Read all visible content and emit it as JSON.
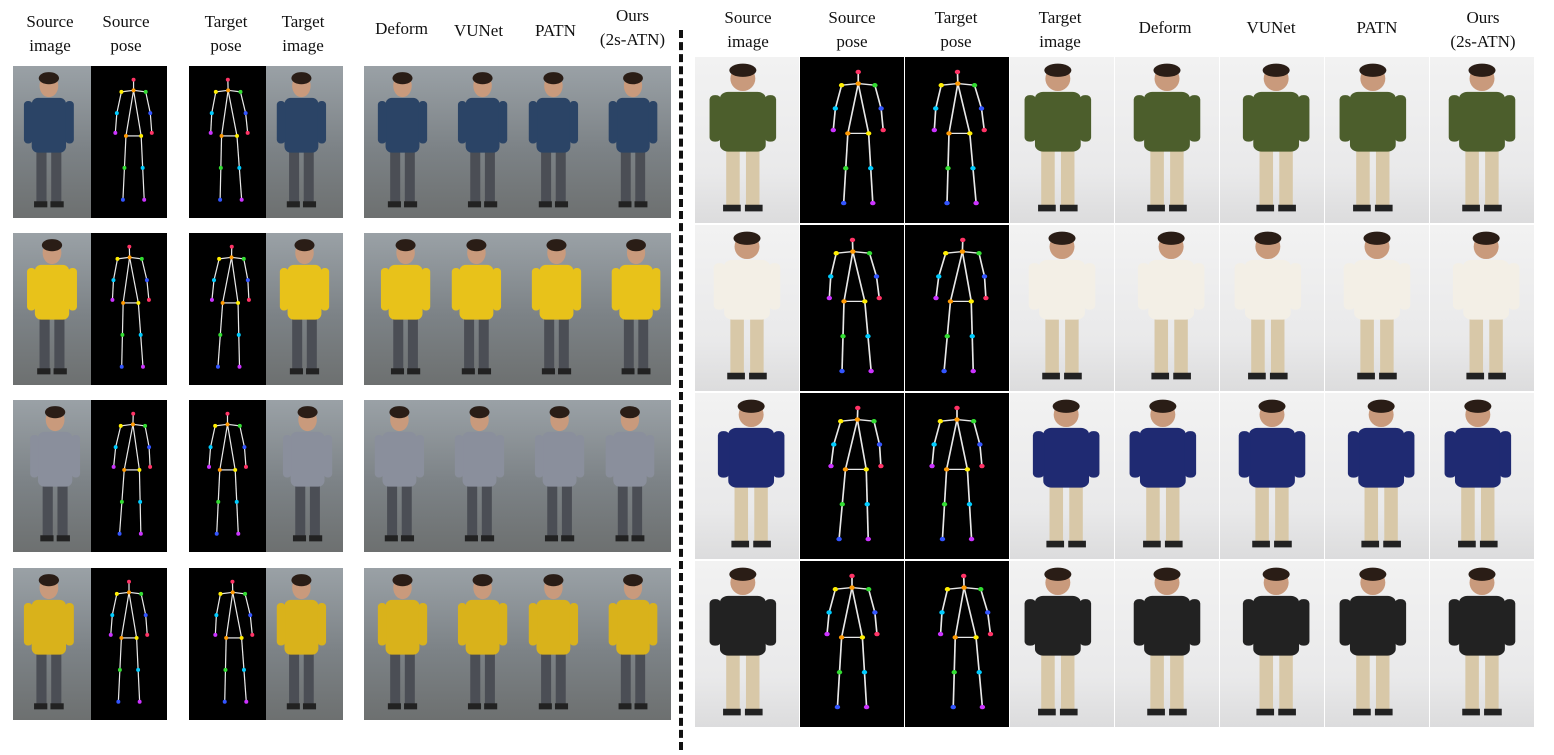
{
  "left_panel": {
    "headers": [
      "Source\nimage",
      "Source\npose",
      "Target\npose",
      "Target\nimage",
      "Deform",
      "VUNet",
      "PATN",
      "Ours\n(2s-ATN)"
    ]
  },
  "right_panel": {
    "headers": [
      "Source\nimage",
      "Source\npose",
      "Target\npose",
      "Target\nimage",
      "Deform",
      "VUNet",
      "PATN",
      "Ours\n(2s-ATN)"
    ]
  },
  "colors": {
    "pose_background": "#000000",
    "skeleton_line": "#e8e8e8",
    "joint_colors": [
      "#ff3366",
      "#ff9900",
      "#ffee00",
      "#33dd33",
      "#00ccff",
      "#3355ff",
      "#cc33ff"
    ],
    "market_shirts": [
      "#2b4466",
      "#e8c21a",
      "#8a8f9c",
      "#d9b21b"
    ],
    "deepfashion_clothes": [
      "#4c5e2c",
      "#f3efe6",
      "#1f2a72",
      "#222222"
    ]
  }
}
